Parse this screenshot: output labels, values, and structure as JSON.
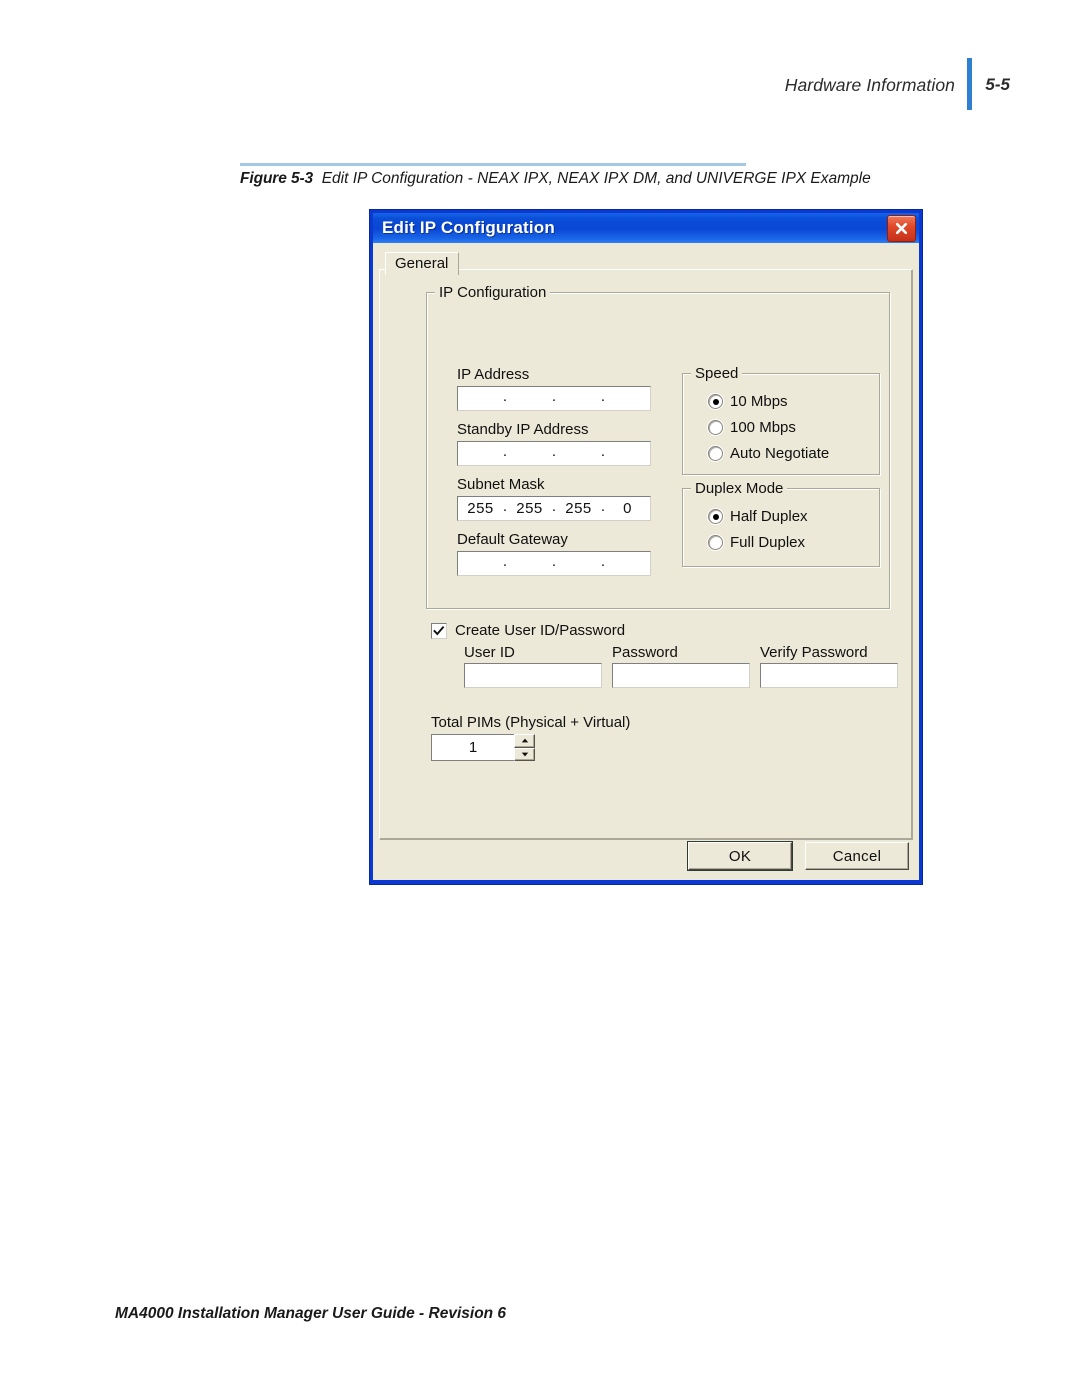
{
  "page": {
    "header_title": "Hardware Information",
    "header_page_number": "5-5",
    "footer": "MA4000 Installation Manager User Guide - Revision 6",
    "accent_rule_color": "#a3c9e6",
    "accent_bar_color": "#2f7fd0"
  },
  "figure": {
    "number": "Figure 5-3",
    "caption": "Edit IP Configuration - NEAX IPX, NEAX IPX DM, and UNIVERGE IPX Example"
  },
  "dialog": {
    "title": "Edit IP Configuration",
    "titlebar_color": "#0a46d4",
    "face_color": "#ece9d8",
    "close_icon": "close-icon",
    "tabs": [
      {
        "label": "General",
        "selected": true
      }
    ],
    "ip_configuration": {
      "group_label": "IP Configuration",
      "fields": [
        {
          "name": "ip-address",
          "label": "IP Address",
          "octets": [
            "",
            "",
            "",
            ""
          ],
          "separator": "."
        },
        {
          "name": "standby-ip-address",
          "label": "Standby IP Address",
          "octets": [
            "",
            "",
            "",
            ""
          ],
          "separator": "."
        },
        {
          "name": "subnet-mask",
          "label": "Subnet Mask",
          "octets": [
            "255",
            "255",
            "255",
            "0"
          ],
          "separator": "."
        },
        {
          "name": "default-gateway",
          "label": "Default Gateway",
          "octets": [
            "",
            "",
            "",
            ""
          ],
          "separator": "."
        }
      ],
      "speed": {
        "group_label": "Speed",
        "options": [
          {
            "label": "10 Mbps",
            "selected": true
          },
          {
            "label": "100 Mbps",
            "selected": false
          },
          {
            "label": "Auto Negotiate",
            "selected": false
          }
        ]
      },
      "duplex_mode": {
        "group_label": "Duplex Mode",
        "options": [
          {
            "label": "Half Duplex",
            "selected": true
          },
          {
            "label": "Full Duplex",
            "selected": false
          }
        ]
      }
    },
    "credentials": {
      "checkbox_label": "Create User ID/Password",
      "checked": true,
      "fields": [
        {
          "name": "user-id",
          "label": "User ID",
          "value": ""
        },
        {
          "name": "password",
          "label": "Password",
          "value": ""
        },
        {
          "name": "verify-password",
          "label": "Verify Password",
          "value": ""
        }
      ]
    },
    "total_pims": {
      "label": "Total PIMs (Physical + Virtual)",
      "value": "1"
    },
    "buttons": {
      "ok": "OK",
      "cancel": "Cancel"
    }
  }
}
